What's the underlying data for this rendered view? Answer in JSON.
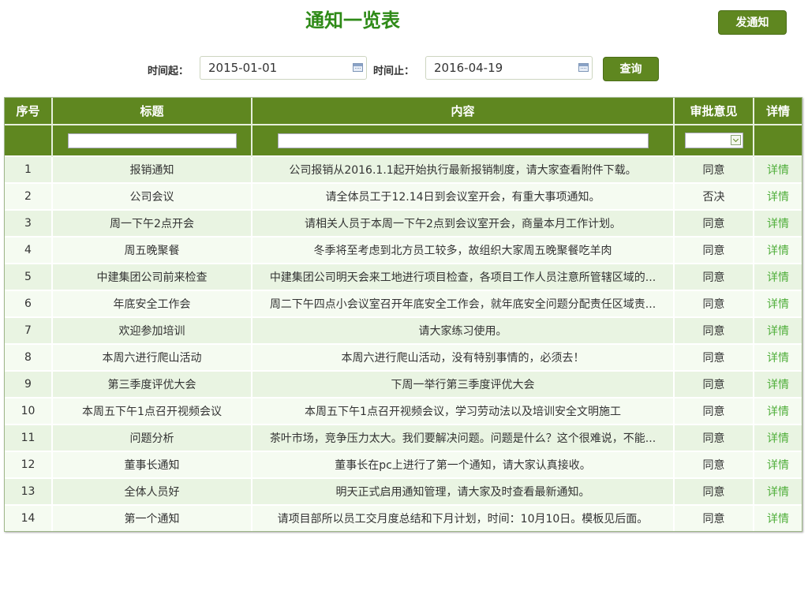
{
  "header": {
    "title": "通知一览表",
    "publish_label": "发通知"
  },
  "search": {
    "start_label": "时间起：",
    "start_value": "2015-01-01",
    "end_label": "时间止：",
    "end_value": "2016-04-19",
    "query_label": "查询",
    "calendar_icon": "calendar-icon"
  },
  "table": {
    "columns": [
      "序号",
      "标题",
      "内容",
      "审批意见",
      "详情"
    ],
    "rows": [
      {
        "no": "1",
        "title": "报销通知",
        "content": "公司报销从2016.1.1起开始执行最新报销制度，请大家查看附件下载。",
        "approval": "同意",
        "detail": "详情"
      },
      {
        "no": "2",
        "title": "公司会议",
        "content": "请全体员工于12.14日到会议室开会，有重大事项通知。",
        "approval": "否决",
        "detail": "详情"
      },
      {
        "no": "3",
        "title": "周一下午2点开会",
        "content": "请相关人员于本周一下午2点到会议室开会，商量本月工作计划。",
        "approval": "同意",
        "detail": "详情"
      },
      {
        "no": "4",
        "title": "周五晚聚餐",
        "content": "冬季将至考虑到北方员工较多，故组织大家周五晚聚餐吃羊肉",
        "approval": "同意",
        "detail": "详情"
      },
      {
        "no": "5",
        "title": "中建集团公司前来检查",
        "content": "中建集团公司明天会来工地进行项目检查，各项目工作人员注意所管辖区域的...",
        "approval": "同意",
        "detail": "详情"
      },
      {
        "no": "6",
        "title": "年底安全工作会",
        "content": "周二下午四点小会议室召开年底安全工作会，就年底安全问题分配责任区域责...",
        "approval": "同意",
        "detail": "详情"
      },
      {
        "no": "7",
        "title": "欢迎参加培训",
        "content": "请大家练习使用。",
        "approval": "同意",
        "detail": "详情"
      },
      {
        "no": "8",
        "title": "本周六进行爬山活动",
        "content": "本周六进行爬山活动，没有特别事情的，必须去！",
        "approval": "同意",
        "detail": "详情"
      },
      {
        "no": "9",
        "title": "第三季度评优大会",
        "content": "下周一举行第三季度评优大会",
        "approval": "同意",
        "detail": "详情"
      },
      {
        "no": "10",
        "title": "本周五下午1点召开视频会议",
        "content": "本周五下午1点召开视频会议，学习劳动法以及培训安全文明施工",
        "approval": "同意",
        "detail": "详情"
      },
      {
        "no": "11",
        "title": "问题分析",
        "content": "茶叶市场，竞争压力太大。我们要解决问题。问题是什么？这个很难说，不能...",
        "approval": "同意",
        "detail": "详情"
      },
      {
        "no": "12",
        "title": "董事长通知",
        "content": "董事长在pc上进行了第一个通知，请大家认真接收。",
        "approval": "同意",
        "detail": "详情"
      },
      {
        "no": "13",
        "title": "全体人员好",
        "content": "明天正式启用通知管理，请大家及时查看最新通知。",
        "approval": "同意",
        "detail": "详情"
      },
      {
        "no": "14",
        "title": "第一个通知",
        "content": "请项目部所以员工交月度总结和下月计划，时间：10月10日。模板见后面。",
        "approval": "同意",
        "detail": "详情"
      }
    ]
  },
  "colors": {
    "accent": "#5f8720",
    "title": "#2e8a17",
    "link": "#4fae3a",
    "row_odd": "#e9f4e2",
    "row_even": "#f5fbf1"
  }
}
